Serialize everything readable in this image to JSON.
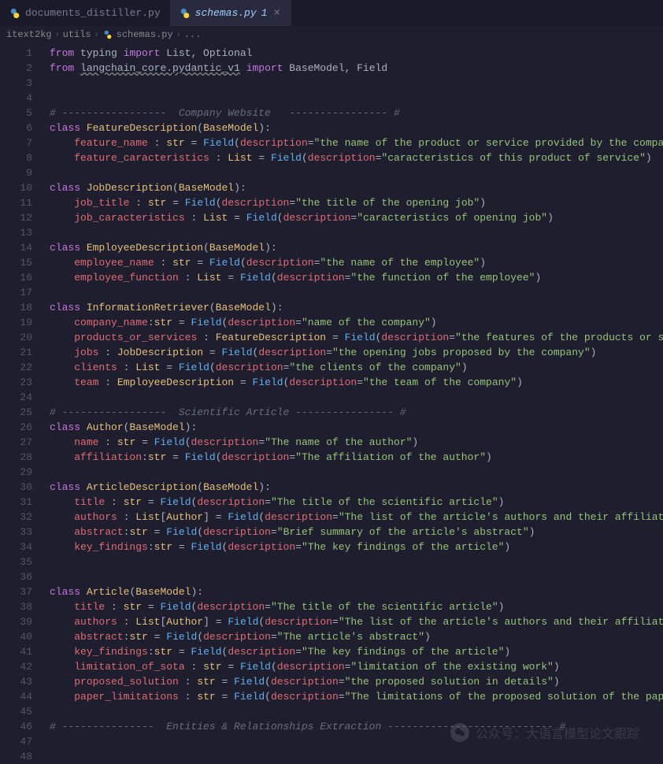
{
  "tabs": [
    {
      "label": "documents_distiller.py",
      "active": false
    },
    {
      "label": "schemas.py",
      "modified": "1",
      "active": true
    }
  ],
  "breadcrumb": {
    "parts": [
      "itext2kg",
      "utils",
      "schemas.py",
      "..."
    ]
  },
  "gutter": {
    "start": 1,
    "end": 48
  },
  "code": {
    "l1": {
      "from": "from",
      "mod": "typing",
      "imp": "import",
      "names": "List, Optional"
    },
    "l2": {
      "from": "from",
      "mod": "langchain_core.pydantic_v1",
      "imp": "import",
      "names": "BaseModel, Field"
    },
    "l5": "# -----------------  Company Website   ---------------- #",
    "l6": {
      "cls": "FeatureDescription",
      "base": "BaseModel"
    },
    "l7": {
      "name": "feature_name",
      "type": "str",
      "desc": "the name of the product or service provided by the company"
    },
    "l8": {
      "name": "feature_caracteristics",
      "type": "List",
      "desc": "caracteristics of this product of service"
    },
    "l10": {
      "cls": "JobDescription",
      "base": "BaseModel"
    },
    "l11": {
      "name": "job_title",
      "type": "str",
      "desc": "the title of the opening job"
    },
    "l12": {
      "name": "job_caracteristics",
      "type": "List",
      "desc": "caracteristics of opening job"
    },
    "l14": {
      "cls": "EmployeeDescription",
      "base": "BaseModel"
    },
    "l15": {
      "name": "employee_name",
      "type": "str",
      "desc": "the name of the employee"
    },
    "l16": {
      "name": "employee_function",
      "type": "List",
      "desc": "the function of the employee"
    },
    "l18": {
      "cls": "InformationRetriever",
      "base": "BaseModel"
    },
    "l19": {
      "name": "company_name",
      "type": "str",
      "desc": "name of the company"
    },
    "l20": {
      "name": "products_or_services",
      "type": "FeatureDescription",
      "desc": "the features of the products or services pro"
    },
    "l21": {
      "name": "jobs",
      "type": "JobDescription",
      "desc": "the opening jobs proposed by the company"
    },
    "l22": {
      "name": "clients",
      "type": "List",
      "desc": "the clients of the company"
    },
    "l23": {
      "name": "team",
      "type": "EmployeeDescription",
      "desc": "the team of the company"
    },
    "l25": "# -----------------  Scientific Article ---------------- #",
    "l26": {
      "cls": "Author",
      "base": "BaseModel"
    },
    "l27": {
      "name": "name",
      "type": "str",
      "desc": "The name of the author"
    },
    "l28": {
      "name": "affiliation",
      "type": "str",
      "desc": "The affiliation of the author"
    },
    "l30": {
      "cls": "ArticleDescription",
      "base": "BaseModel"
    },
    "l31": {
      "name": "title",
      "type": "str",
      "desc": "The title of the scientific article"
    },
    "l32": {
      "name": "authors",
      "type": "List",
      "inner": "Author",
      "desc": "The list of the article's authors and their affiliation"
    },
    "l33": {
      "name": "abstract",
      "type": "str",
      "desc": "Brief summary of the article's abstract"
    },
    "l34": {
      "name": "key_findings",
      "type": "str",
      "desc": "The key findings of the article"
    },
    "l37": {
      "cls": "Article",
      "base": "BaseModel"
    },
    "l38": {
      "name": "title",
      "type": "str",
      "desc": "The title of the scientific article"
    },
    "l39": {
      "name": "authors",
      "type": "List",
      "inner": "Author",
      "desc": "The list of the article's authors and their affiliation"
    },
    "l40": {
      "name": "abstract",
      "type": "str",
      "desc": "The article's abstract"
    },
    "l41": {
      "name": "key_findings",
      "type": "str",
      "desc": "The key findings of the article"
    },
    "l42": {
      "name": "limitation_of_sota",
      "type": "str",
      "desc": "limitation of the existing work"
    },
    "l43": {
      "name": "proposed_solution",
      "type": "str",
      "desc": "the proposed solution in details"
    },
    "l44": {
      "name": "paper_limitations",
      "type": "str",
      "desc": "The limitations of the proposed solution of the paper"
    },
    "l46": "# ---------------  Entities & Relationships Extraction --------------------------- #"
  },
  "watermark": "公众号：大语言模型论文跟踪"
}
